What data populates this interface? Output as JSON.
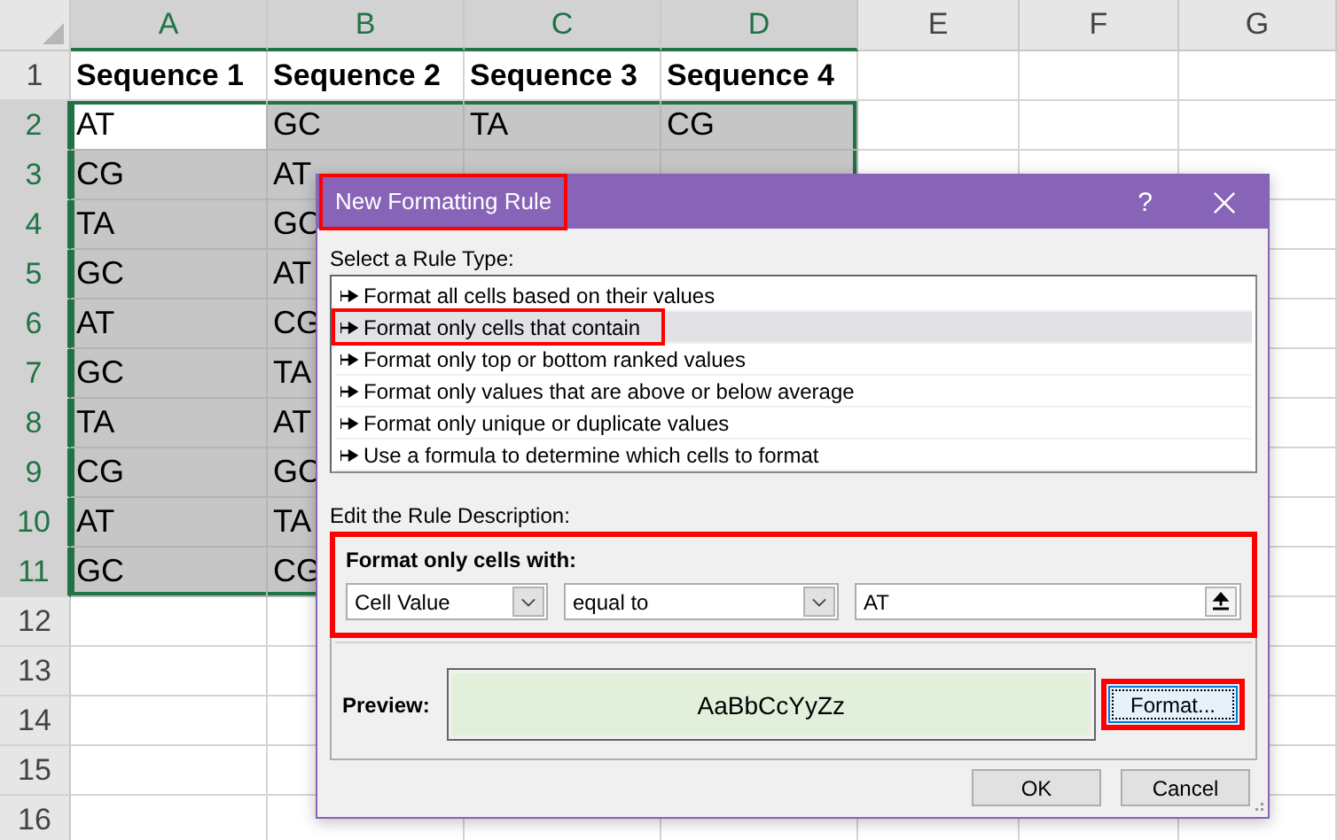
{
  "sheet": {
    "columns": [
      {
        "label": "A",
        "selected": true
      },
      {
        "label": "B",
        "selected": true
      },
      {
        "label": "C",
        "selected": true
      },
      {
        "label": "D",
        "selected": true
      },
      {
        "label": "E",
        "selected": false
      },
      {
        "label": "F",
        "selected": false
      },
      {
        "label": "G",
        "selected": false
      }
    ],
    "rows": [
      {
        "label": "1",
        "selected": false,
        "kind": "header",
        "cells": [
          {
            "text": "Sequence 1",
            "selected": false,
            "active": false
          },
          {
            "text": "Sequence 2",
            "selected": false,
            "active": false
          },
          {
            "text": "Sequence 3",
            "selected": false,
            "active": false
          },
          {
            "text": "Sequence 4",
            "selected": false,
            "active": false
          }
        ]
      },
      {
        "label": "2",
        "selected": true,
        "kind": "data",
        "cells": [
          {
            "text": "AT",
            "selected": true,
            "active": true
          },
          {
            "text": "GC",
            "selected": true,
            "active": false
          },
          {
            "text": "TA",
            "selected": true,
            "active": false
          },
          {
            "text": "CG",
            "selected": true,
            "active": false
          }
        ]
      },
      {
        "label": "3",
        "selected": true,
        "kind": "data",
        "cells": [
          {
            "text": "CG",
            "selected": true,
            "active": false
          },
          {
            "text": "AT",
            "selected": true,
            "active": false
          },
          {
            "selected": true,
            "active": false
          },
          {
            "selected": true,
            "active": false
          }
        ]
      },
      {
        "label": "4",
        "selected": true,
        "kind": "data",
        "cells": [
          {
            "text": "TA",
            "selected": true,
            "active": false
          },
          {
            "text": "GC",
            "selected": true,
            "active": false
          }
        ]
      },
      {
        "label": "5",
        "selected": true,
        "kind": "data",
        "cells": [
          {
            "text": "GC",
            "selected": true,
            "active": false
          },
          {
            "text": "AT",
            "selected": true,
            "active": false
          }
        ]
      },
      {
        "label": "6",
        "selected": true,
        "kind": "data",
        "cells": [
          {
            "text": "AT",
            "selected": true,
            "active": false
          },
          {
            "text": "CG",
            "selected": true,
            "active": false
          }
        ]
      },
      {
        "label": "7",
        "selected": true,
        "kind": "data",
        "cells": [
          {
            "text": "GC",
            "selected": true,
            "active": false
          },
          {
            "text": "TA",
            "selected": true,
            "active": false
          }
        ]
      },
      {
        "label": "8",
        "selected": true,
        "kind": "data",
        "cells": [
          {
            "text": "TA",
            "selected": true,
            "active": false
          },
          {
            "text": "AT",
            "selected": true,
            "active": false
          }
        ]
      },
      {
        "label": "9",
        "selected": true,
        "kind": "data",
        "cells": [
          {
            "text": "CG",
            "selected": true,
            "active": false
          },
          {
            "text": "GC",
            "selected": true,
            "active": false
          }
        ]
      },
      {
        "label": "10",
        "selected": true,
        "kind": "data",
        "cells": [
          {
            "text": "AT",
            "selected": true,
            "active": false
          },
          {
            "text": "TA",
            "selected": true,
            "active": false
          }
        ]
      },
      {
        "label": "11",
        "selected": true,
        "kind": "data",
        "cells": [
          {
            "text": "GC",
            "selected": true,
            "active": false
          },
          {
            "text": "CG",
            "selected": true,
            "active": false
          }
        ]
      },
      {
        "label": "12",
        "selected": false
      },
      {
        "label": "13",
        "selected": false
      },
      {
        "label": "14",
        "selected": false
      },
      {
        "label": "15",
        "selected": false
      },
      {
        "label": "16",
        "selected": false
      }
    ]
  },
  "dialog": {
    "title": "New Formatting Rule",
    "title_highlighted": true,
    "help": "?",
    "rule_type_label": "Select a Rule Type:",
    "rule_types": [
      {
        "label": "Format all cells based on their values",
        "selected": false,
        "highlighted": false
      },
      {
        "label": "Format only cells that contain",
        "selected": true,
        "highlighted": true
      },
      {
        "label": "Format only top or bottom ranked values",
        "selected": false,
        "highlighted": false
      },
      {
        "label": "Format only values that are above or below average",
        "selected": false,
        "highlighted": false
      },
      {
        "label": "Format only unique or duplicate values",
        "selected": false,
        "highlighted": false
      },
      {
        "label": "Use a formula to determine which cells to format",
        "selected": false,
        "highlighted": false
      }
    ],
    "description_label": "Edit the Rule Description:",
    "condition": {
      "highlighted": true,
      "heading": "Format only cells with:",
      "operand": "Cell Value",
      "operator": "equal to",
      "value": "AT"
    },
    "preview": {
      "label": "Preview:",
      "sample": "AaBbCcYyZz"
    },
    "format_button": {
      "label": "Format...",
      "highlighted": true
    },
    "buttons": [
      "OK",
      "Cancel"
    ]
  }
}
